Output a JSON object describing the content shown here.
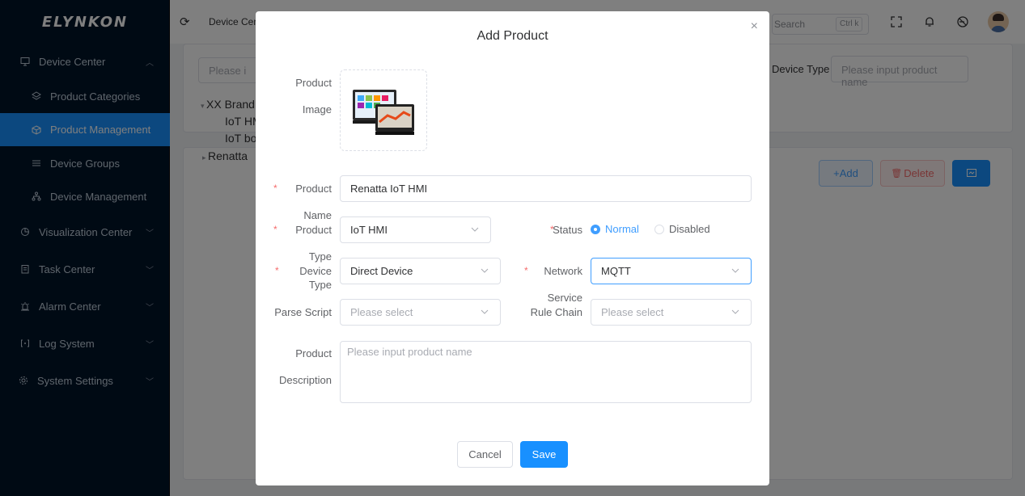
{
  "app": {
    "logo": "ELYNKON"
  },
  "sidebar": {
    "items": [
      {
        "label": "Device Center",
        "icon": "monitor-icon",
        "chevron": "^"
      },
      {
        "label": "Product Categories",
        "icon": "layers-icon"
      },
      {
        "label": "Product Management",
        "icon": "cube-icon",
        "active": true
      },
      {
        "label": "Device Groups",
        "icon": "list-icon"
      },
      {
        "label": "Device Management",
        "icon": "tree-icon"
      },
      {
        "label": "Visualization Center",
        "icon": "pie-chart-icon",
        "chevron": "⌄"
      },
      {
        "label": "Task Center",
        "icon": "clipboard-icon",
        "chevron": "⌄"
      },
      {
        "label": "Alarm Center",
        "icon": "alarm-icon",
        "chevron": "⌄"
      },
      {
        "label": "Log System",
        "icon": "log-icon",
        "chevron": "⌄"
      },
      {
        "label": "System Settings",
        "icon": "gear-icon",
        "chevron": "⌄"
      }
    ]
  },
  "topbar": {
    "breadcrumb": "Device Cent",
    "search_label": "Search",
    "search_shortcut": "Ctrl k"
  },
  "background": {
    "filter_placeholder": "Please i",
    "device_type_label": "Device Type",
    "device_type_placeholder": "Please input product name",
    "tree": [
      "XX Brand",
      "IoT HM",
      "IoT bo",
      "Renatta"
    ],
    "add_label": "+Add",
    "delete_label": "Delete"
  },
  "modal": {
    "title": "Add Product",
    "close": "×",
    "labels": {
      "product_image_1": "Product",
      "product_image_2": "Image",
      "product_name_1": "Product",
      "product_name_2": "Name",
      "product_type_1": "Product",
      "product_type_2": "Type",
      "status": "Status",
      "device_type": "Device Type",
      "network": "Network",
      "parse_script": "Parse Script",
      "service_1": "Service",
      "service_2": "Rule Chain",
      "description_1": "Product",
      "description_2": "Description"
    },
    "values": {
      "product_name": "Renatta IoT HMI",
      "product_type": "IoT HMI",
      "device_type": "Direct Device",
      "network": "MQTT",
      "parse_script_placeholder": "Please select",
      "rule_chain_placeholder": "Please select",
      "description_placeholder": "Please input product name"
    },
    "status_options": {
      "normal": "Normal",
      "disabled": "Disabled",
      "selected": "normal"
    },
    "buttons": {
      "cancel": "Cancel",
      "save": "Save"
    },
    "colors": {
      "primary": "#1890ff",
      "required": "#f56c6c"
    }
  }
}
